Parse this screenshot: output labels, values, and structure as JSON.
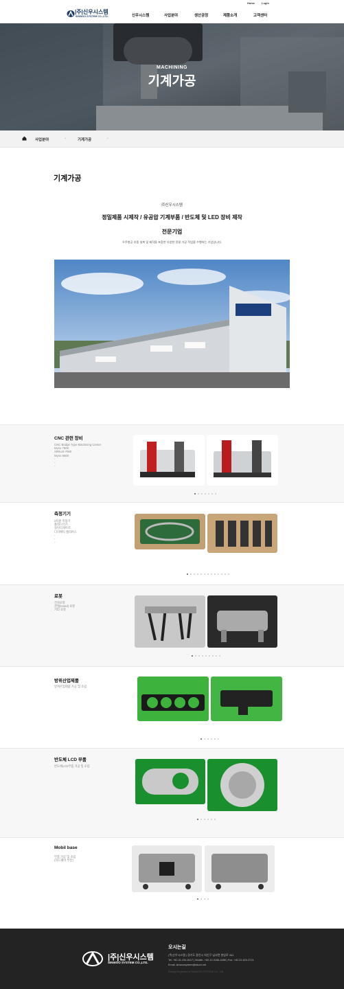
{
  "util": {
    "home": "Home",
    "login": "Login"
  },
  "logo": {
    "kr": "|주|신우시스템",
    "en": "SINWOO SYSTEM CO.,LTD."
  },
  "nav": [
    "신우시스템",
    "사업분야",
    "생산공정",
    "제품소개",
    "고객센터"
  ],
  "hero": {
    "sub": "MACHINING",
    "title": "기계가공"
  },
  "breadcrumb": {
    "level1": "사업분야",
    "level2": "기계가공"
  },
  "page": {
    "title": "기계가공",
    "company": "㈜신우시스템",
    "headline1": "정밀제품 시제작 / 유공압 기계부품 / 반도체 및 LED 장비 제작",
    "headline2": "전문기업",
    "description": "우주항공 부품 설계 및 제작을 포함한 다양한 정밀 가공 작업을 수행하는 기업입니다."
  },
  "sections": [
    {
      "title": "CNC 관련 장비",
      "lines": [
        "CNC Bridge Type Machining Center",
        "Mynx 7500",
        "SIRIUS-7060",
        "Mynx 6500",
        "-",
        "-",
        "-"
      ],
      "dots": 7,
      "active": 0
    },
    {
      "title": "측정기기",
      "lines": [
        "2차원 측정기",
        "홀테스터기",
        "실린더게이지",
        "디지메틱 캘리퍼스",
        "-",
        "-",
        "-"
      ],
      "dots": 13,
      "active": 0
    },
    {
      "title": "로봇",
      "lines": [
        "전자로봇",
        "관절(Hand) 로봇",
        "기타 로봇"
      ],
      "dots": 9,
      "active": 0
    },
    {
      "title": "방위산업제품",
      "lines": [
        "방위산업제품 가공 및 조립"
      ],
      "dots": 6,
      "active": 0
    },
    {
      "title": "반도체 LCD 부품",
      "lines": [
        "반도체LCD부품 가공 및 조립"
      ],
      "dots": 6,
      "active": 0
    },
    {
      "title": "Mobil base",
      "lines": [
        "부품 가공 및 조립",
        "(하드웨어 부분)"
      ],
      "dots": 4,
      "active": 0
    }
  ],
  "footer": {
    "title": "오시는길",
    "line1": "(주)신우시스템  |  경기도 용인시 처인구 남사면 봉암로 341",
    "line2": "Tel. +82-31-334-8417  |  Mobile. +82-10-3166-4486  |  Fax. +82-31-624-3721",
    "line3": "Email. sinwoosystem@daum.net",
    "copy": "Design Engineer of SINWOO SYSTEM Co., Ltd.",
    "logo_kr": "|주|신우시스템",
    "logo_en": "SINWOO SYSTEM CO.,LTD."
  }
}
